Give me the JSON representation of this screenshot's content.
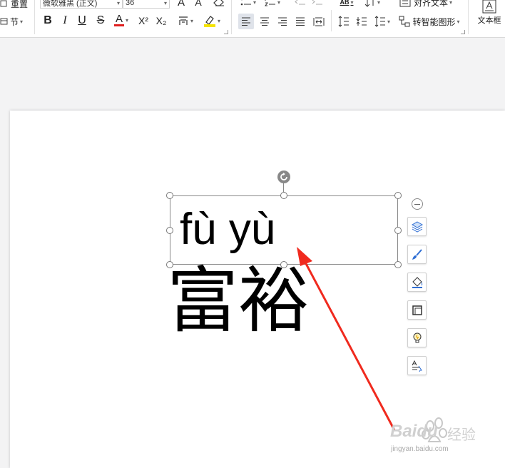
{
  "toolbar": {
    "reset_label": "重置",
    "section_label": "节",
    "font_name": "微软雅黑 (正文)",
    "font_size": "36",
    "align_text_label": "对齐文本",
    "smart_shape_label": "转智能图形",
    "textbox_label": "文本框",
    "bold": "B",
    "italic": "I",
    "underline": "U",
    "strike": "S",
    "font_color": "A",
    "grow_font": "A",
    "shrink_font": "A",
    "superscript": "X²",
    "subscript": "X₂",
    "ab_label": "AB"
  },
  "slide": {
    "pinyin": "fù yù",
    "hanzi": "富裕"
  },
  "watermark": {
    "brand": "Baidu",
    "brand_cn": "经验",
    "url": "jingyan.baidu.com"
  },
  "colors": {
    "arrow": "#f02a1e",
    "font_color_underline": "#e02020",
    "highlight": "#f5e400",
    "icon_blue": "#2f6ed3"
  }
}
